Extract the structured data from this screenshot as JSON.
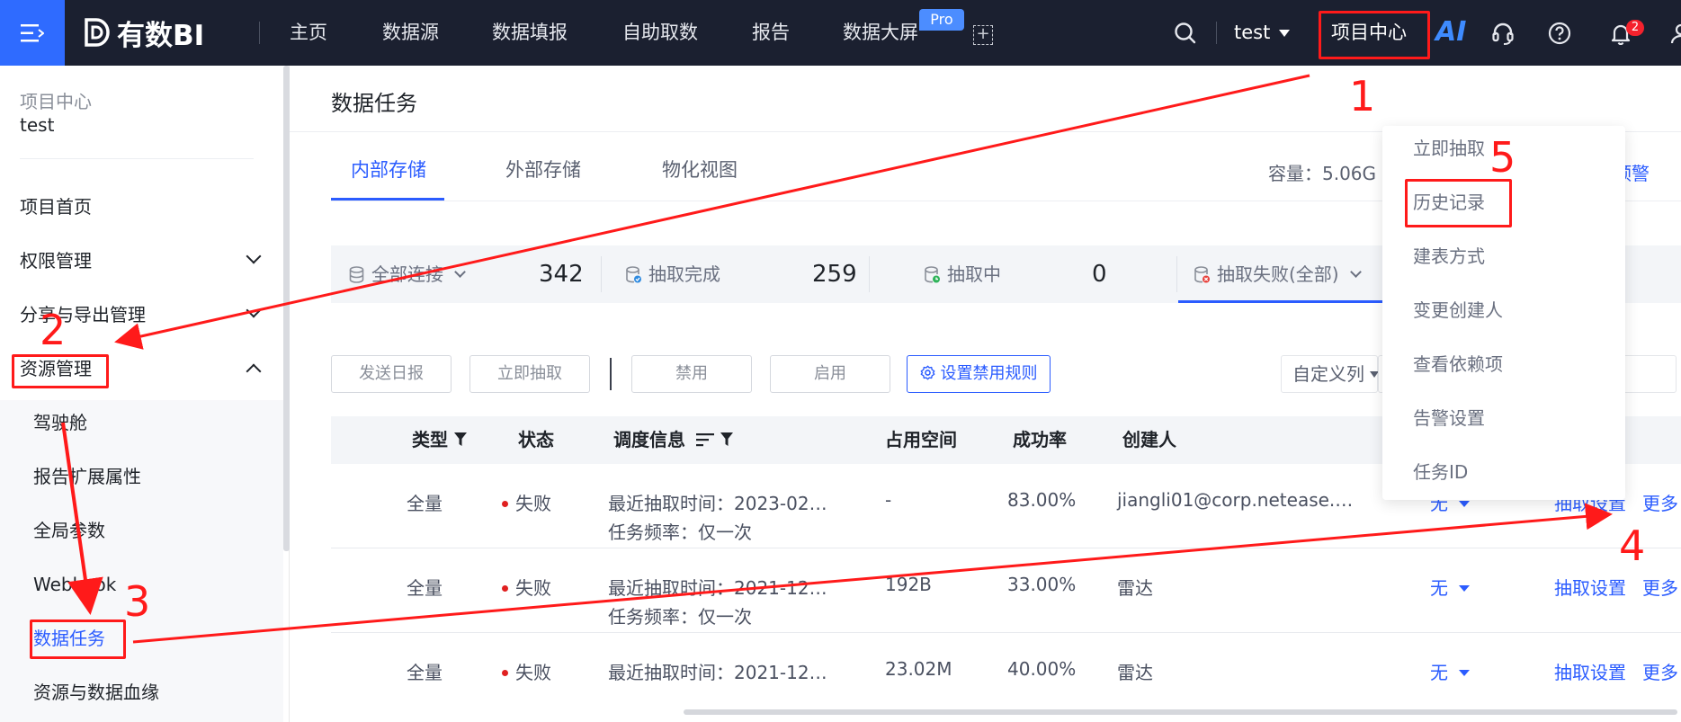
{
  "topbar": {
    "brand": "有数BI",
    "nav": [
      "主页",
      "数据源",
      "数据填报",
      "自助取数",
      "报告",
      "数据大屏"
    ],
    "pro_badge": "Pro",
    "add_tab": "+",
    "user": "test",
    "project_center": "项目中心",
    "ai": "AI",
    "notification_count": "2",
    "colors": {
      "bg": "#1b2030",
      "accent": "#2f6bff"
    },
    "icons": [
      "menu-icon",
      "search-icon",
      "headset-icon",
      "help-icon",
      "bell-icon"
    ]
  },
  "sidebar": {
    "project_label": "项目中心",
    "project_name": "test",
    "items": [
      "项目首页",
      "权限管理",
      "分享与导出管理",
      "资源管理"
    ],
    "sub_items": [
      "驾驶舱",
      "报告扩展属性",
      "全局参数",
      "Webhook",
      "数据任务",
      "资源与数据血缘"
    ],
    "active": "数据任务"
  },
  "main": {
    "title": "数据任务",
    "tabs": [
      "内部存储",
      "外部存储",
      "物化视图"
    ],
    "capacity": "容量：5.06G",
    "capacity_warning": "量预警",
    "stats": [
      {
        "label": "全部连接",
        "value": "342"
      },
      {
        "label": "抽取完成",
        "value": "259"
      },
      {
        "label": "抽取中",
        "value": "0"
      },
      {
        "label": "抽取失败(全部)",
        "value": ""
      }
    ],
    "buttons": [
      "发送日报",
      "立即抽取",
      "禁用",
      "启用",
      "设置禁用规则"
    ],
    "custom_columns": "自定义列",
    "table": {
      "headers": [
        "类型",
        "状态",
        "调度信息",
        "占用空间",
        "成功率",
        "创建人"
      ],
      "rows": [
        {
          "type": "全量",
          "status": "失败",
          "sched1": "最近抽取时间：2023-02…",
          "sched2": "任务频率：仅一次",
          "space": "-",
          "rate": "83.00%",
          "creator": "jiangli01@corp.netease.…",
          "col7": "无",
          "action": "抽取设置",
          "more": "更多"
        },
        {
          "type": "全量",
          "status": "失败",
          "sched1": "最近抽取时间：2021-12…",
          "sched2": "任务频率：仅一次",
          "space": "192B",
          "rate": "33.00%",
          "creator": "雷达",
          "col7": "无",
          "action": "抽取设置",
          "more": "更多"
        },
        {
          "type": "全量",
          "status": "失败",
          "sched1": "最近抽取时间：2021-12…",
          "sched2": "",
          "space": "23.02M",
          "rate": "40.00%",
          "creator": "雷达",
          "col7": "无",
          "action": "抽取设置",
          "more": "更多"
        }
      ]
    }
  },
  "dropdown": {
    "items": [
      "立即抽取",
      "历史记录",
      "建表方式",
      "变更创建人",
      "查看依赖项",
      "告警设置",
      "任务ID"
    ]
  },
  "annotations": {
    "numbers": [
      "1",
      "2",
      "3",
      "4",
      "5"
    ],
    "color": "#ff1a1a"
  }
}
